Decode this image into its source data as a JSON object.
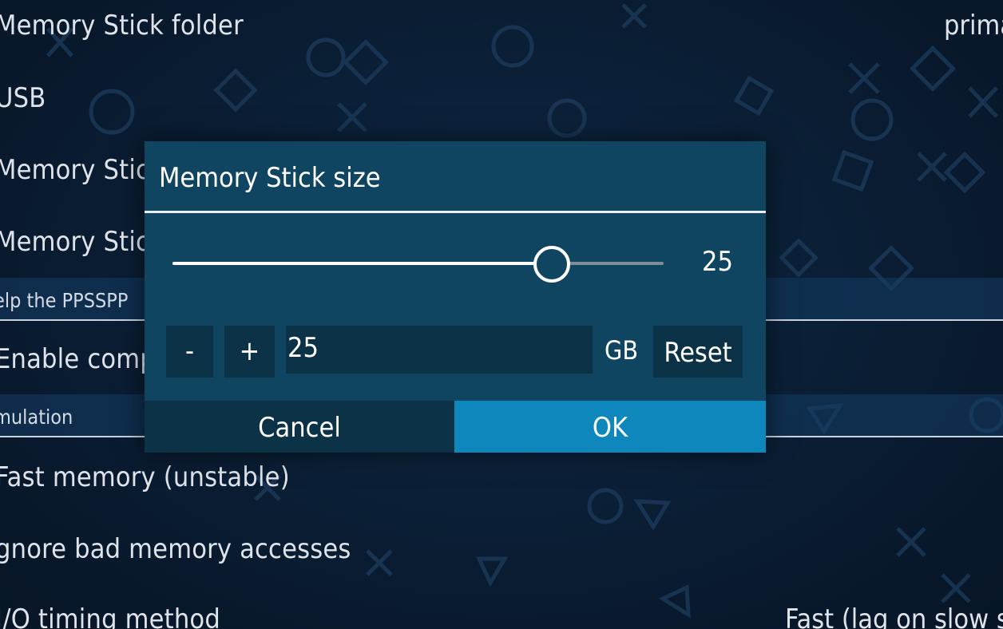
{
  "background": {
    "rows": [
      {
        "label": "Memory Stick folder",
        "value": "prima"
      },
      {
        "label": "USB"
      },
      {
        "label": "Memory Stic"
      },
      {
        "label": "Memory Stic"
      }
    ],
    "section_help": "elp the PPSSPP",
    "row_compat": "Enable comp",
    "section_emulation": "mulation",
    "rows_after": [
      {
        "label": "Fast memory (unstable)"
      },
      {
        "label": "gnore bad memory accesses"
      },
      {
        "label": "I/O timing method",
        "value": "Fast (lag on slow s"
      }
    ]
  },
  "dialog": {
    "title": "Memory Stick size",
    "slider": {
      "value": 25,
      "fraction": 0.77,
      "label": "25"
    },
    "minus_label": "-",
    "plus_label": "+",
    "input_value": "25",
    "unit": "GB",
    "reset_label": "Reset",
    "cancel_label": "Cancel",
    "ok_label": "OK"
  },
  "colors": {
    "dialog_bg": "#0f4560",
    "button_dark": "#0b3247",
    "ok_accent": "#0e87bd",
    "page_bg": "#0a1d33"
  },
  "icons": [
    "playstation-shape-pattern"
  ]
}
